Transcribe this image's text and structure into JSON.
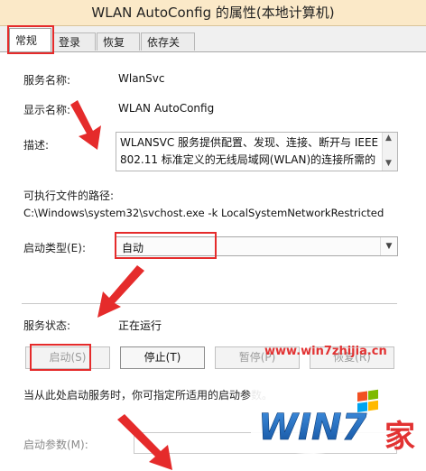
{
  "window": {
    "title": "WLAN AutoConfig 的属性(本地计算机)"
  },
  "tabs": [
    {
      "label": "常规",
      "active": true
    },
    {
      "label": "登录",
      "active": false
    },
    {
      "label": "恢复",
      "active": false
    },
    {
      "label": "依存关系",
      "active": false
    }
  ],
  "general": {
    "service_name_label": "服务名称:",
    "service_name": "WlanSvc",
    "display_name_label": "显示名称:",
    "display_name": "WLAN AutoConfig",
    "description_label": "描述:",
    "description": "WLANSVC 服务提供配置、发现、连接、断开与 IEEE\n802.11 标准定义的无线局域网(WLAN)的连接所需的",
    "exe_path_label": "可执行文件的路径:",
    "exe_path": "C:\\Windows\\system32\\svchost.exe -k LocalSystemNetworkRestricted",
    "startup_type_label": "启动类型(E):",
    "startup_type_value": "自动",
    "service_status_label": "服务状态:",
    "service_status_value": "正在运行",
    "buttons": {
      "start": "启动(S)",
      "stop": "停止(T)",
      "pause": "暂停(P)",
      "resume": "恢复(R)"
    },
    "hint": "当从此处启动服务时，你可指定所适用的启动参数。",
    "start_params_label": "启动参数(M):",
    "start_params_value": ""
  },
  "watermark": {
    "site": "www.win7zhijia.cn",
    "brand": "WIN7",
    "brand_suffix": "家"
  },
  "colors": {
    "annotation_red": "#e52b2b",
    "titlebar": "#fbe9c8"
  }
}
